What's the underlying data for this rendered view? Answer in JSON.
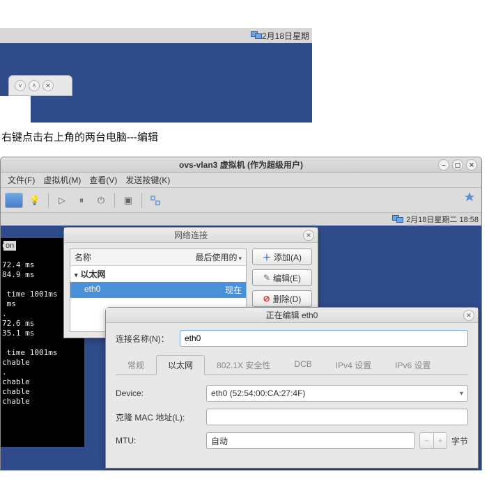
{
  "top": {
    "date": "2月18日星期"
  },
  "caption": "右键点击右上角的两台电脑---编辑",
  "vmhost": {
    "title": "ovs-vlan3 虚拟机 (作为超级用户)",
    "menu": [
      "文件(F)",
      "虚拟机(M)",
      "查看(V)",
      "发送按键(K)"
    ],
    "status": "2月18日星期二 18:58"
  },
  "terminal": "on\n\n72.4 ms\n84.9 ms\n\n time 1001ms\n ms\n.\n72.6 ms\n35.1 ms\n\n time 1001ms\nchable\n.\nchable\nchable\nchable",
  "term_on": "on",
  "netconn": {
    "title": "网络连接",
    "cols": {
      "name": "名称",
      "last": "最后使用的"
    },
    "group": "以太网",
    "row": {
      "name": "eth0",
      "last": "现在"
    },
    "buttons": {
      "add": "添加(A)",
      "edit": "编辑(E)",
      "del": "删除(D)"
    }
  },
  "edit": {
    "title": "正在编辑 eth0",
    "connlabel": "连接名称(N)：",
    "connvalue": "eth0",
    "tabs": [
      "常规",
      "以太网",
      "802.1X 安全性",
      "DCB",
      "IPv4 设置",
      "IPv6 设置"
    ],
    "device_label": "Device:",
    "device_value": "eth0 (52:54:00:CA:27:4F)",
    "mac_label": "克隆 MAC 地址(L):",
    "mac_value": "",
    "mtu_label": "MTU:",
    "mtu_value": "自动",
    "mtu_unit": "字节"
  }
}
